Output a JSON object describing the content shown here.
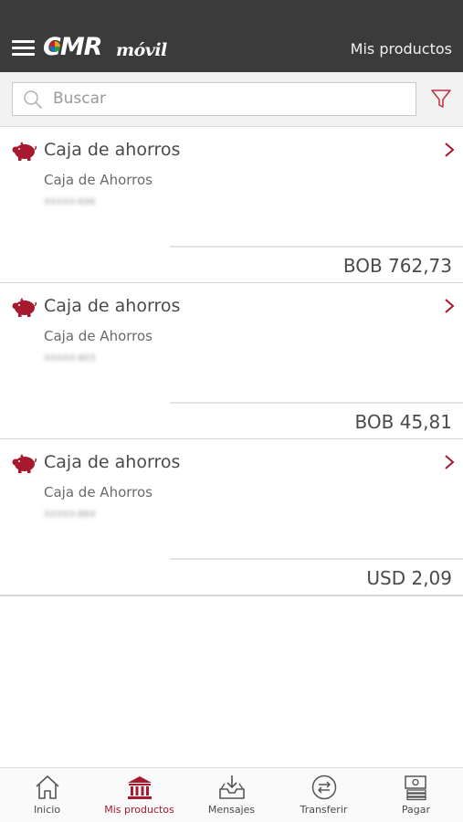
{
  "header": {
    "logo_main": "CMR",
    "logo_sub": "móvil",
    "page_title": "Mis productos",
    "menu_icon": "hamburger-menu-icon"
  },
  "search": {
    "placeholder": "Buscar",
    "value": "",
    "filter_icon": "funnel-filter-icon"
  },
  "products": [
    {
      "title": "Caja de ahorros",
      "subtitle": "Caja de Ahorros",
      "account": "XXXXX-696",
      "balance": "BOB 762,73",
      "icon": "piggy-bank-icon"
    },
    {
      "title": "Caja de ahorros",
      "subtitle": "Caja de Ahorros",
      "account": "XXXXX-803",
      "balance": "BOB 45,81",
      "icon": "piggy-bank-icon"
    },
    {
      "title": "Caja de ahorros",
      "subtitle": "Caja de Ahorros",
      "account": "XXXXX-884",
      "balance": "USD 2,09",
      "icon": "piggy-bank-icon"
    }
  ],
  "bottom_nav": [
    {
      "label": "Inicio",
      "icon": "home-icon",
      "active": false
    },
    {
      "label": "Mis productos",
      "icon": "bank-icon",
      "active": true
    },
    {
      "label": "Mensajes",
      "icon": "inbox-download-icon",
      "active": false
    },
    {
      "label": "Transferir",
      "icon": "transfer-arrows-icon",
      "active": false
    },
    {
      "label": "Pagar",
      "icon": "payment-bills-icon",
      "active": false
    }
  ],
  "colors": {
    "header_bg": "#3b3b3b",
    "accent": "#a6192e",
    "text": "#4a4a4a"
  }
}
